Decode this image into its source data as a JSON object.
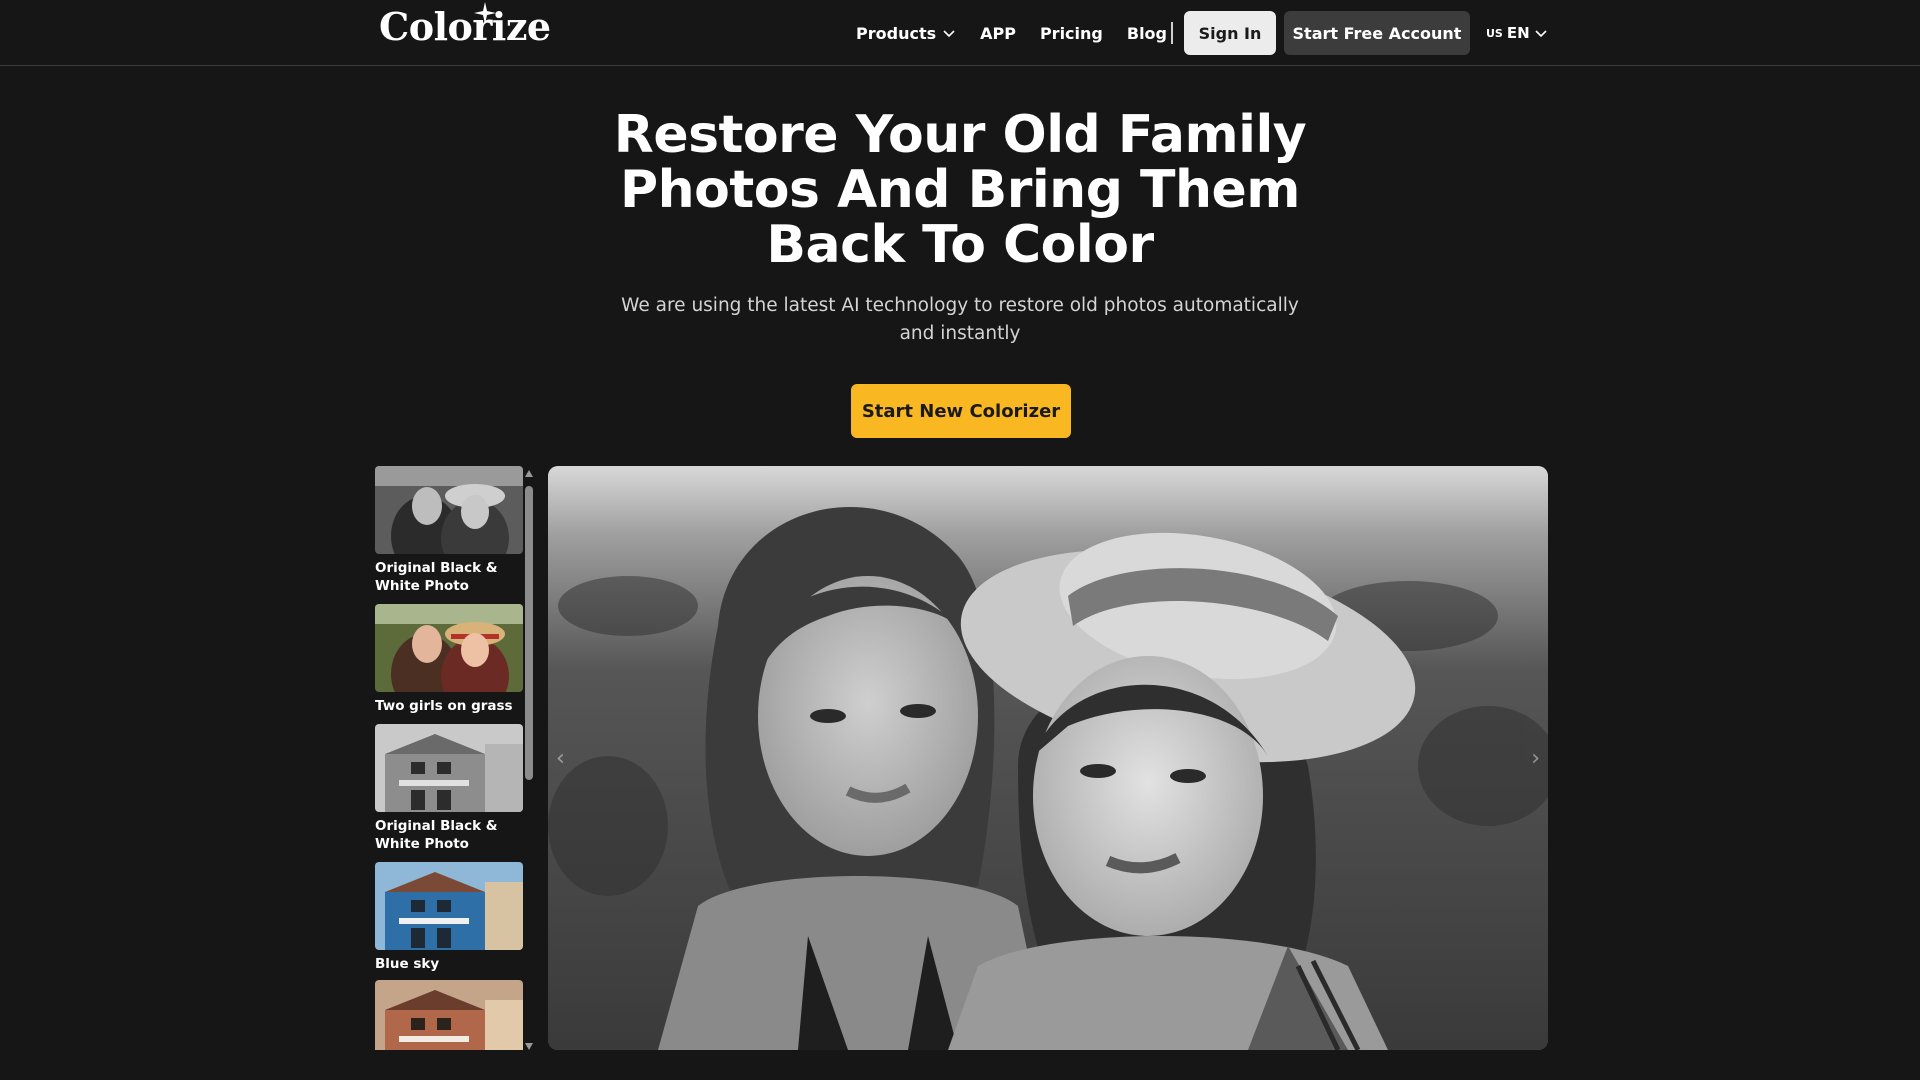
{
  "nav": {
    "logo": "Colorize",
    "links": [
      {
        "label": "Products",
        "has_dropdown": true
      },
      {
        "label": "APP",
        "has_dropdown": false
      },
      {
        "label": "Pricing",
        "has_dropdown": false
      },
      {
        "label": "Blog",
        "has_dropdown": false
      }
    ],
    "sign_in": "Sign In",
    "start_free": "Start Free Account",
    "lang_flag": "US",
    "lang_code": "EN"
  },
  "hero": {
    "title": "Restore Your Old Family Photos And Bring Them Back To Color",
    "subtitle": "We are using the latest AI technology to restore old photos automatically and instantly",
    "cta": "Start New Colorizer"
  },
  "gallery": {
    "items": [
      {
        "label": "Original Black & White Photo",
        "kind": "girls-bw"
      },
      {
        "label": "Two girls on grass",
        "kind": "girls-color"
      },
      {
        "label": "Original Black & White Photo",
        "kind": "house-bw"
      },
      {
        "label": "Blue sky",
        "kind": "house-blue"
      },
      {
        "label": "",
        "kind": "house-warm"
      }
    ]
  },
  "viewer": {
    "image": "black-and-white photo of two girls on grass, one wearing a straw hat"
  },
  "colors": {
    "background": "#161616",
    "accent": "#f9b822",
    "sign_in_bg": "#ececec",
    "start_free_bg": "#3c3c3c"
  }
}
